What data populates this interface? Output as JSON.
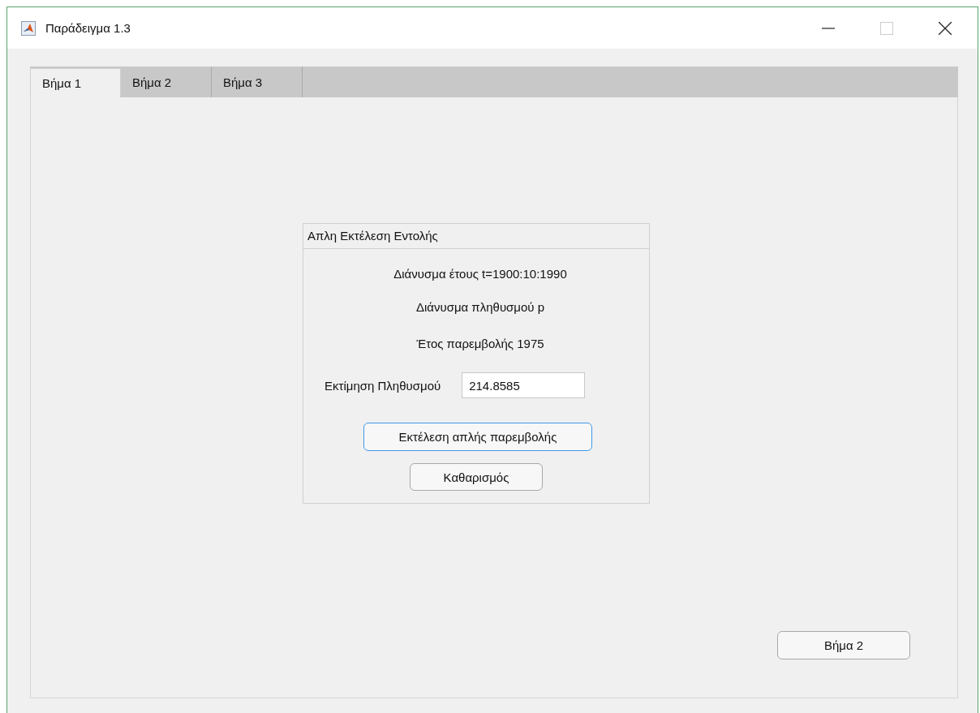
{
  "window": {
    "title": "Παράδειγμα 1.3"
  },
  "tabs": [
    {
      "label": "Βήμα 1",
      "selected": true
    },
    {
      "label": "Βήμα 2",
      "selected": false
    },
    {
      "label": "Βήμα 3",
      "selected": false
    }
  ],
  "panel": {
    "title": "Απλη Εκτέλεση Εντολής",
    "lines": [
      "Διάνυσμα έτους t=1900:10:1990",
      "Διάνυσμα πληθυσμού p",
      "Έτος παρεμβολής 1975"
    ],
    "estimate": {
      "label": "Εκτίμηση Πληθυσμού",
      "value": "214.8585"
    },
    "buttons": [
      {
        "label": "Εκτέλεση απλής παρεμβολής",
        "focused": true
      },
      {
        "label": "Καθαρισμός",
        "focused": false
      }
    ]
  },
  "next_button": {
    "label": "Βήμα 2",
    "focused": false
  }
}
